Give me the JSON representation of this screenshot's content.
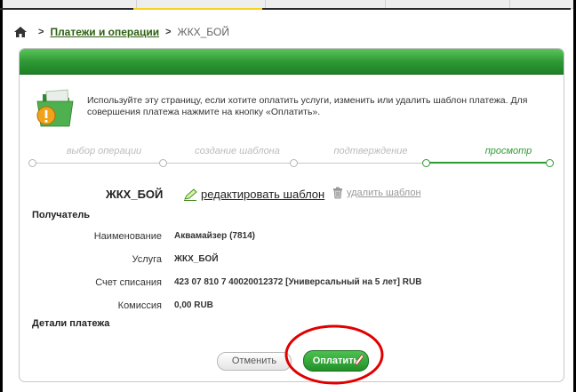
{
  "breadcrumb": {
    "section": "Платежи и операции",
    "current": "ЖКХ_БОЙ"
  },
  "intro": {
    "text": "Используйте эту страницу, если хотите оплатить услуги, изменить или удалить шаблон платежа. Для совершения платежа нажмите на кнопку «Оплатить»."
  },
  "steps": [
    {
      "label": "выбор операции",
      "active": false
    },
    {
      "label": "создание шаблона",
      "active": false
    },
    {
      "label": "подтверждение",
      "active": false
    },
    {
      "label": "просмотр",
      "active": true
    }
  ],
  "template": {
    "name": "ЖКХ_БОЙ",
    "edit_label": "редактировать шаблон",
    "delete_label": "удалить шаблон"
  },
  "recipient": {
    "section_title": "Получатель",
    "fields": [
      {
        "label": "Наименование",
        "value": "Аквамайзер (7814)"
      },
      {
        "label": "Услуга",
        "value": "ЖКХ_БОЙ"
      },
      {
        "label": "Счет списания",
        "value": "423 07 810 7 40020012372  [Универсальный на 5 лет]  RUB"
      },
      {
        "label": "Комиссия",
        "value": "0,00 RUB"
      }
    ]
  },
  "payment_details": {
    "section_title": "Детали платежа"
  },
  "buttons": {
    "cancel": "Отменить",
    "pay": "Оплатить"
  },
  "colors": {
    "brand_green": "#2e9a32",
    "highlight_red": "#e00000"
  }
}
